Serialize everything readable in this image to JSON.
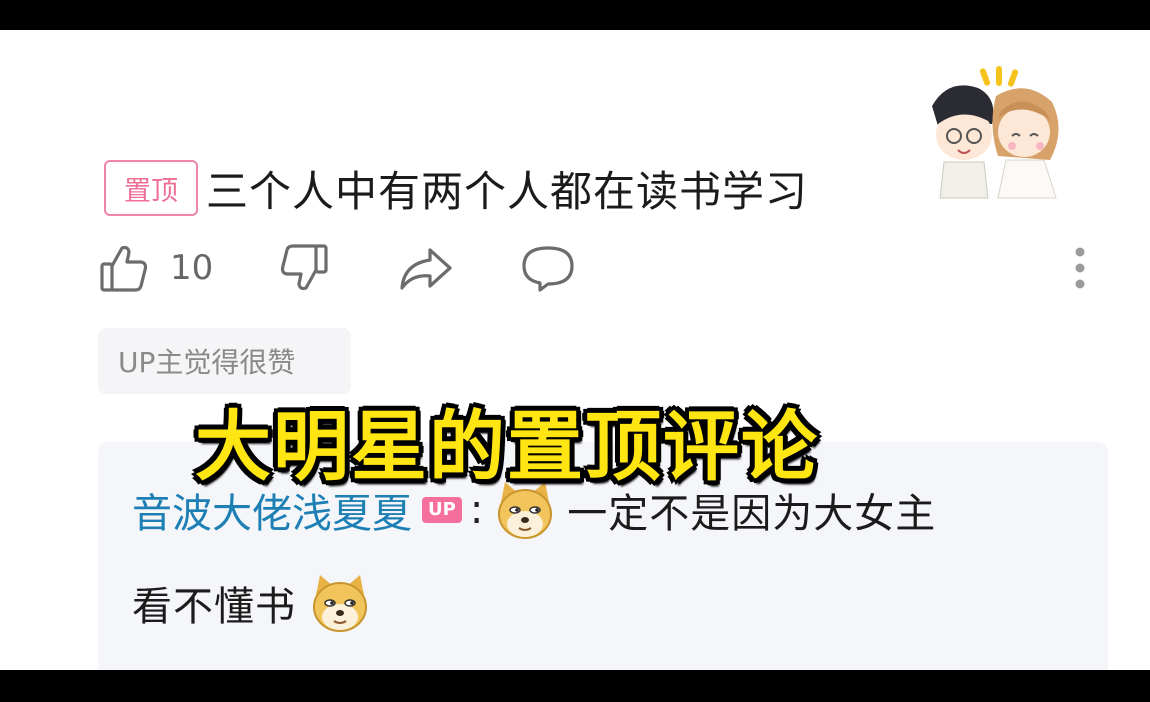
{
  "comment": {
    "pin_label": "置顶",
    "text": "三个人中有两个人都在读书学习",
    "like_count": "10"
  },
  "up_like_tag": "UP主觉得很赞",
  "reply": {
    "author": "音波大佬浅夏夏",
    "author_badge": "UP",
    "colon": ":",
    "line1_text": "一定不是因为大女主",
    "line2_text": "看不懂书",
    "emoji_name": "doge-emoji"
  },
  "overlay_caption": "大明星的置顶评论",
  "colors": {
    "pin": "#ef6e96",
    "author": "#1d7fb3",
    "up_badge": "#f46f9b",
    "caption": "#ffe512"
  },
  "icons": [
    "like-icon",
    "dislike-icon",
    "share-icon",
    "reply-icon",
    "more-icon"
  ]
}
